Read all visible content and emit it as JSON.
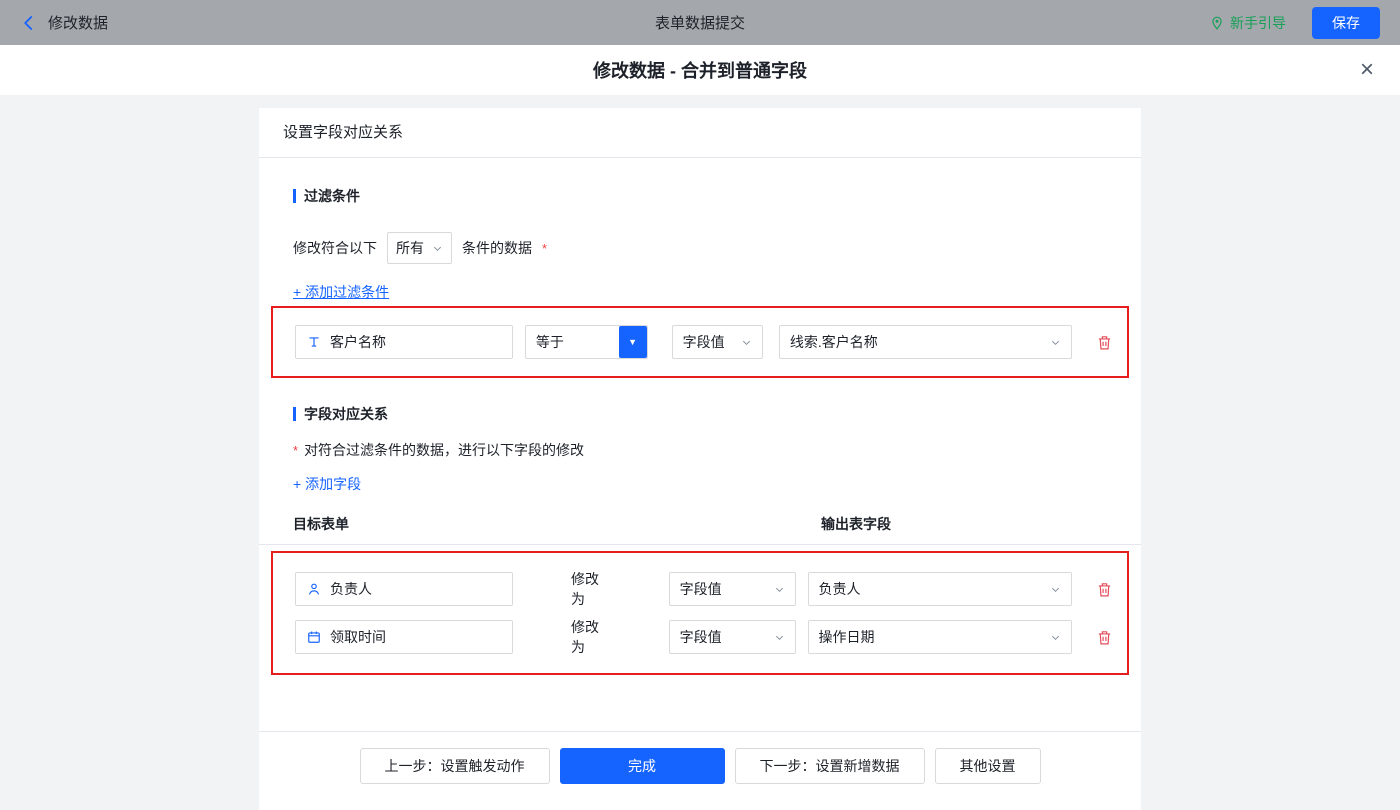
{
  "topbar": {
    "back_label": "修改数据",
    "title": "表单数据提交",
    "guide_label": "新手引导",
    "save_label": "保存"
  },
  "dialog": {
    "title": "修改数据 - 合并到普通字段",
    "close_glyph": "×"
  },
  "card": {
    "header": "设置字段对应关系",
    "filter_section": {
      "title": "过滤条件",
      "condition_prefix": "修改符合以下",
      "condition_select_value": "所有",
      "condition_suffix": "条件的数据",
      "required_mark": "*",
      "add_link": "+ 添加过滤条件",
      "row": {
        "field": "客户名称",
        "operator": "等于",
        "value_type": "字段值",
        "value": "线索.客户名称"
      }
    },
    "mapping_section": {
      "title": "字段对应关系",
      "required_mark": "*",
      "description": "对符合过滤条件的数据，进行以下字段的修改",
      "add_link": "+ 添加字段",
      "col_target": "目标表单",
      "col_output": "输出表字段",
      "rows": [
        {
          "field": "负责人",
          "action": "修改为",
          "value_type": "字段值",
          "value": "负责人"
        },
        {
          "field": "领取时间",
          "action": "修改为",
          "value_type": "字段值",
          "value": "操作日期"
        }
      ]
    },
    "footer": {
      "prev_label": "上一步：设置触发动作",
      "done_label": "完成",
      "next_label": "下一步：设置新增数据",
      "other_label": "其他设置"
    }
  },
  "icons": {
    "back": "chevron-left",
    "guide": "location-pin",
    "close": "x",
    "text_field": "text-cursor",
    "person": "user",
    "calendar": "calendar",
    "dropdown": "chevron-down",
    "delete": "trash"
  },
  "colors": {
    "accent": "#1664ff",
    "success_green": "#18a058",
    "danger_red": "#e34d59",
    "highlight_border": "#e61d1d",
    "topbar_bg": "#a4a7ac"
  }
}
